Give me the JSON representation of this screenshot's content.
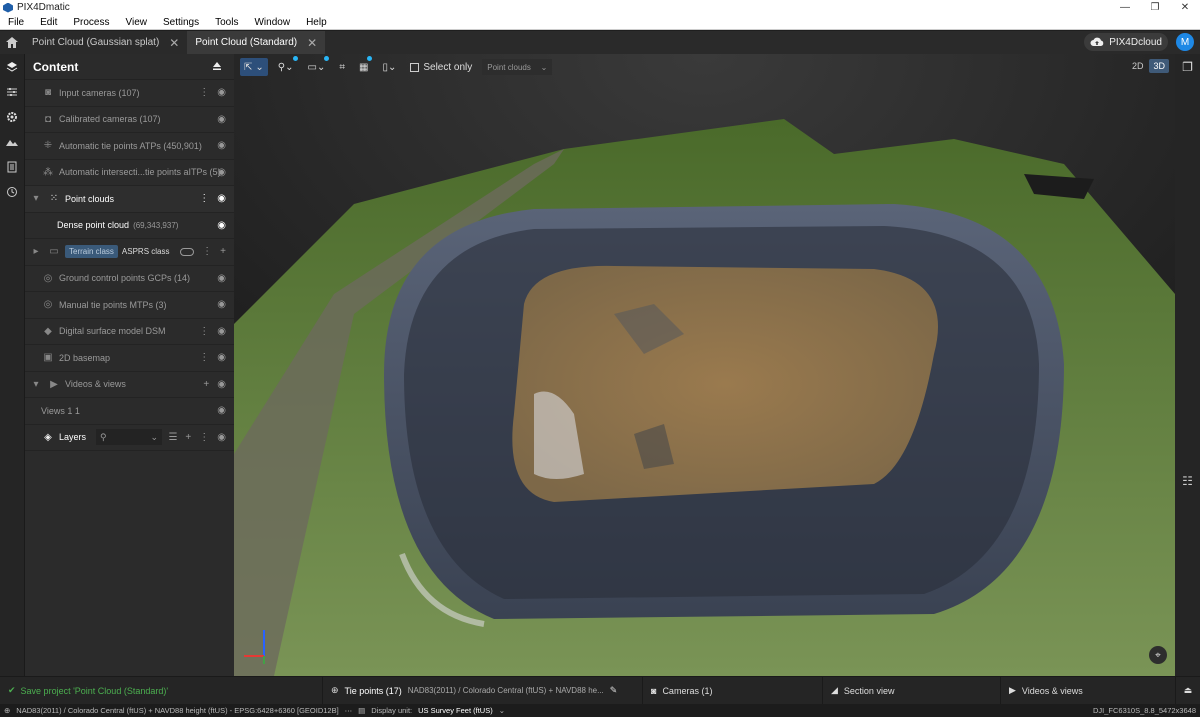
{
  "app": {
    "title": "PIX4Dmatic",
    "window_controls": [
      "—",
      "❐",
      "✕"
    ]
  },
  "menu": [
    "File",
    "Edit",
    "Process",
    "View",
    "Settings",
    "Tools",
    "Window",
    "Help"
  ],
  "tabs": [
    {
      "label": "Point Cloud (Gaussian splat)",
      "active": false
    },
    {
      "label": "Point Cloud (Standard)",
      "active": true
    }
  ],
  "account": {
    "cloud_label": "PIX4Dcloud",
    "avatar": "M"
  },
  "content": {
    "title": "Content",
    "items": [
      {
        "label": "Input cameras (107)",
        "icon": "camera-icon"
      },
      {
        "label": "Calibrated cameras (107)",
        "icon": "calibrated-camera-icon"
      },
      {
        "label": "Automatic tie points ATPs (450,901)",
        "icon": "tie-points-icon"
      },
      {
        "label": "Automatic intersecti...tie points aITPs (5)",
        "icon": "intersection-icon"
      }
    ],
    "point_clouds": {
      "label": "Point clouds",
      "child_label": "Dense point cloud",
      "child_count": "(69,343,937)"
    },
    "class_row": {
      "terrain": "Terrain class",
      "asprs": "ASPRS class"
    },
    "items2": [
      {
        "label": "Ground control points GCPs (14)",
        "icon": "gcp-icon"
      },
      {
        "label": "Manual tie points MTPs (3)",
        "icon": "mtp-icon"
      },
      {
        "label": "Digital surface model DSM",
        "icon": "dsm-icon"
      },
      {
        "label": "2D basemap",
        "icon": "basemap-icon"
      }
    ],
    "videos": {
      "label": "Videos & views",
      "child": "Views 1 1"
    },
    "layers": {
      "label": "Layers"
    }
  },
  "toolbar": {
    "select_only": "Select only",
    "dropdown": "Point clouds",
    "view_2d": "2D",
    "view_3d": "3D",
    "mode": "3D"
  },
  "bottom": {
    "save_msg": "Save project 'Point Cloud (Standard)'",
    "tie_label": "Tie points (17)",
    "tie_crs": "NAD83(2011) / Colorado Central (ftUS) + NAVD88 he...",
    "cameras": "Cameras (1)",
    "section": "Section view",
    "videos": "Videos & views"
  },
  "status": {
    "crs": "NAD83(2011) / Colorado Central (ftUS) + NAVD88 height (ftUS) - EPSG:6428+6360 [GEOID12B]",
    "unit_label": "Display unit:",
    "unit": "US Survey Feet (ftUS)",
    "image": "DJI_FC6310S_8.8_5472x3648"
  },
  "colors": {
    "accent": "#29b6f6",
    "active_tool": "#2d4f7a",
    "panel": "#2b2b2b",
    "success": "#4caf50"
  }
}
